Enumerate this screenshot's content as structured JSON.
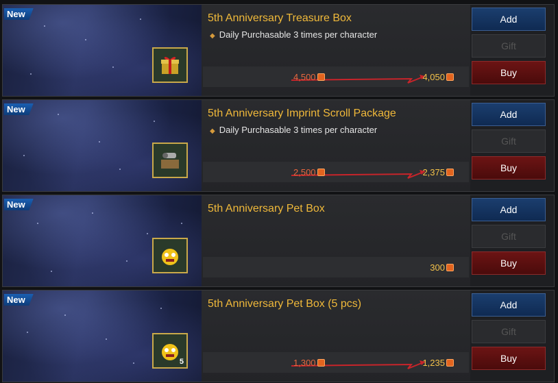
{
  "items": [
    {
      "badge": "New",
      "title": "5th Anniversary Treasure Box",
      "note": "Daily Purchasable 3 times per character",
      "old_price": "4,500",
      "price": "4,050",
      "icon": "gift-box-icon"
    },
    {
      "badge": "New",
      "title": "5th Anniversary Imprint Scroll Package",
      "note": "Daily Purchasable 3 times per character",
      "old_price": "2,500",
      "price": "2,375",
      "icon": "scroll-package-icon"
    },
    {
      "badge": "New",
      "title": "5th Anniversary Pet Box",
      "note": "",
      "old_price": "",
      "price": "300",
      "icon": "pet-box-icon"
    },
    {
      "badge": "New",
      "title": "5th Anniversary Pet Box (5 pcs)",
      "note": "",
      "old_price": "1,300",
      "price": "1,235",
      "icon": "pet-box-5-icon",
      "icon_count": "5"
    }
  ],
  "buttons": {
    "add": "Add",
    "gift": "Gift",
    "buy": "Buy"
  },
  "colors": {
    "title": "#f0b93a",
    "old_price": "#e7673f",
    "new_price": "#f4c24a",
    "add": "#1b3e6e",
    "buy": "#6c1414"
  }
}
